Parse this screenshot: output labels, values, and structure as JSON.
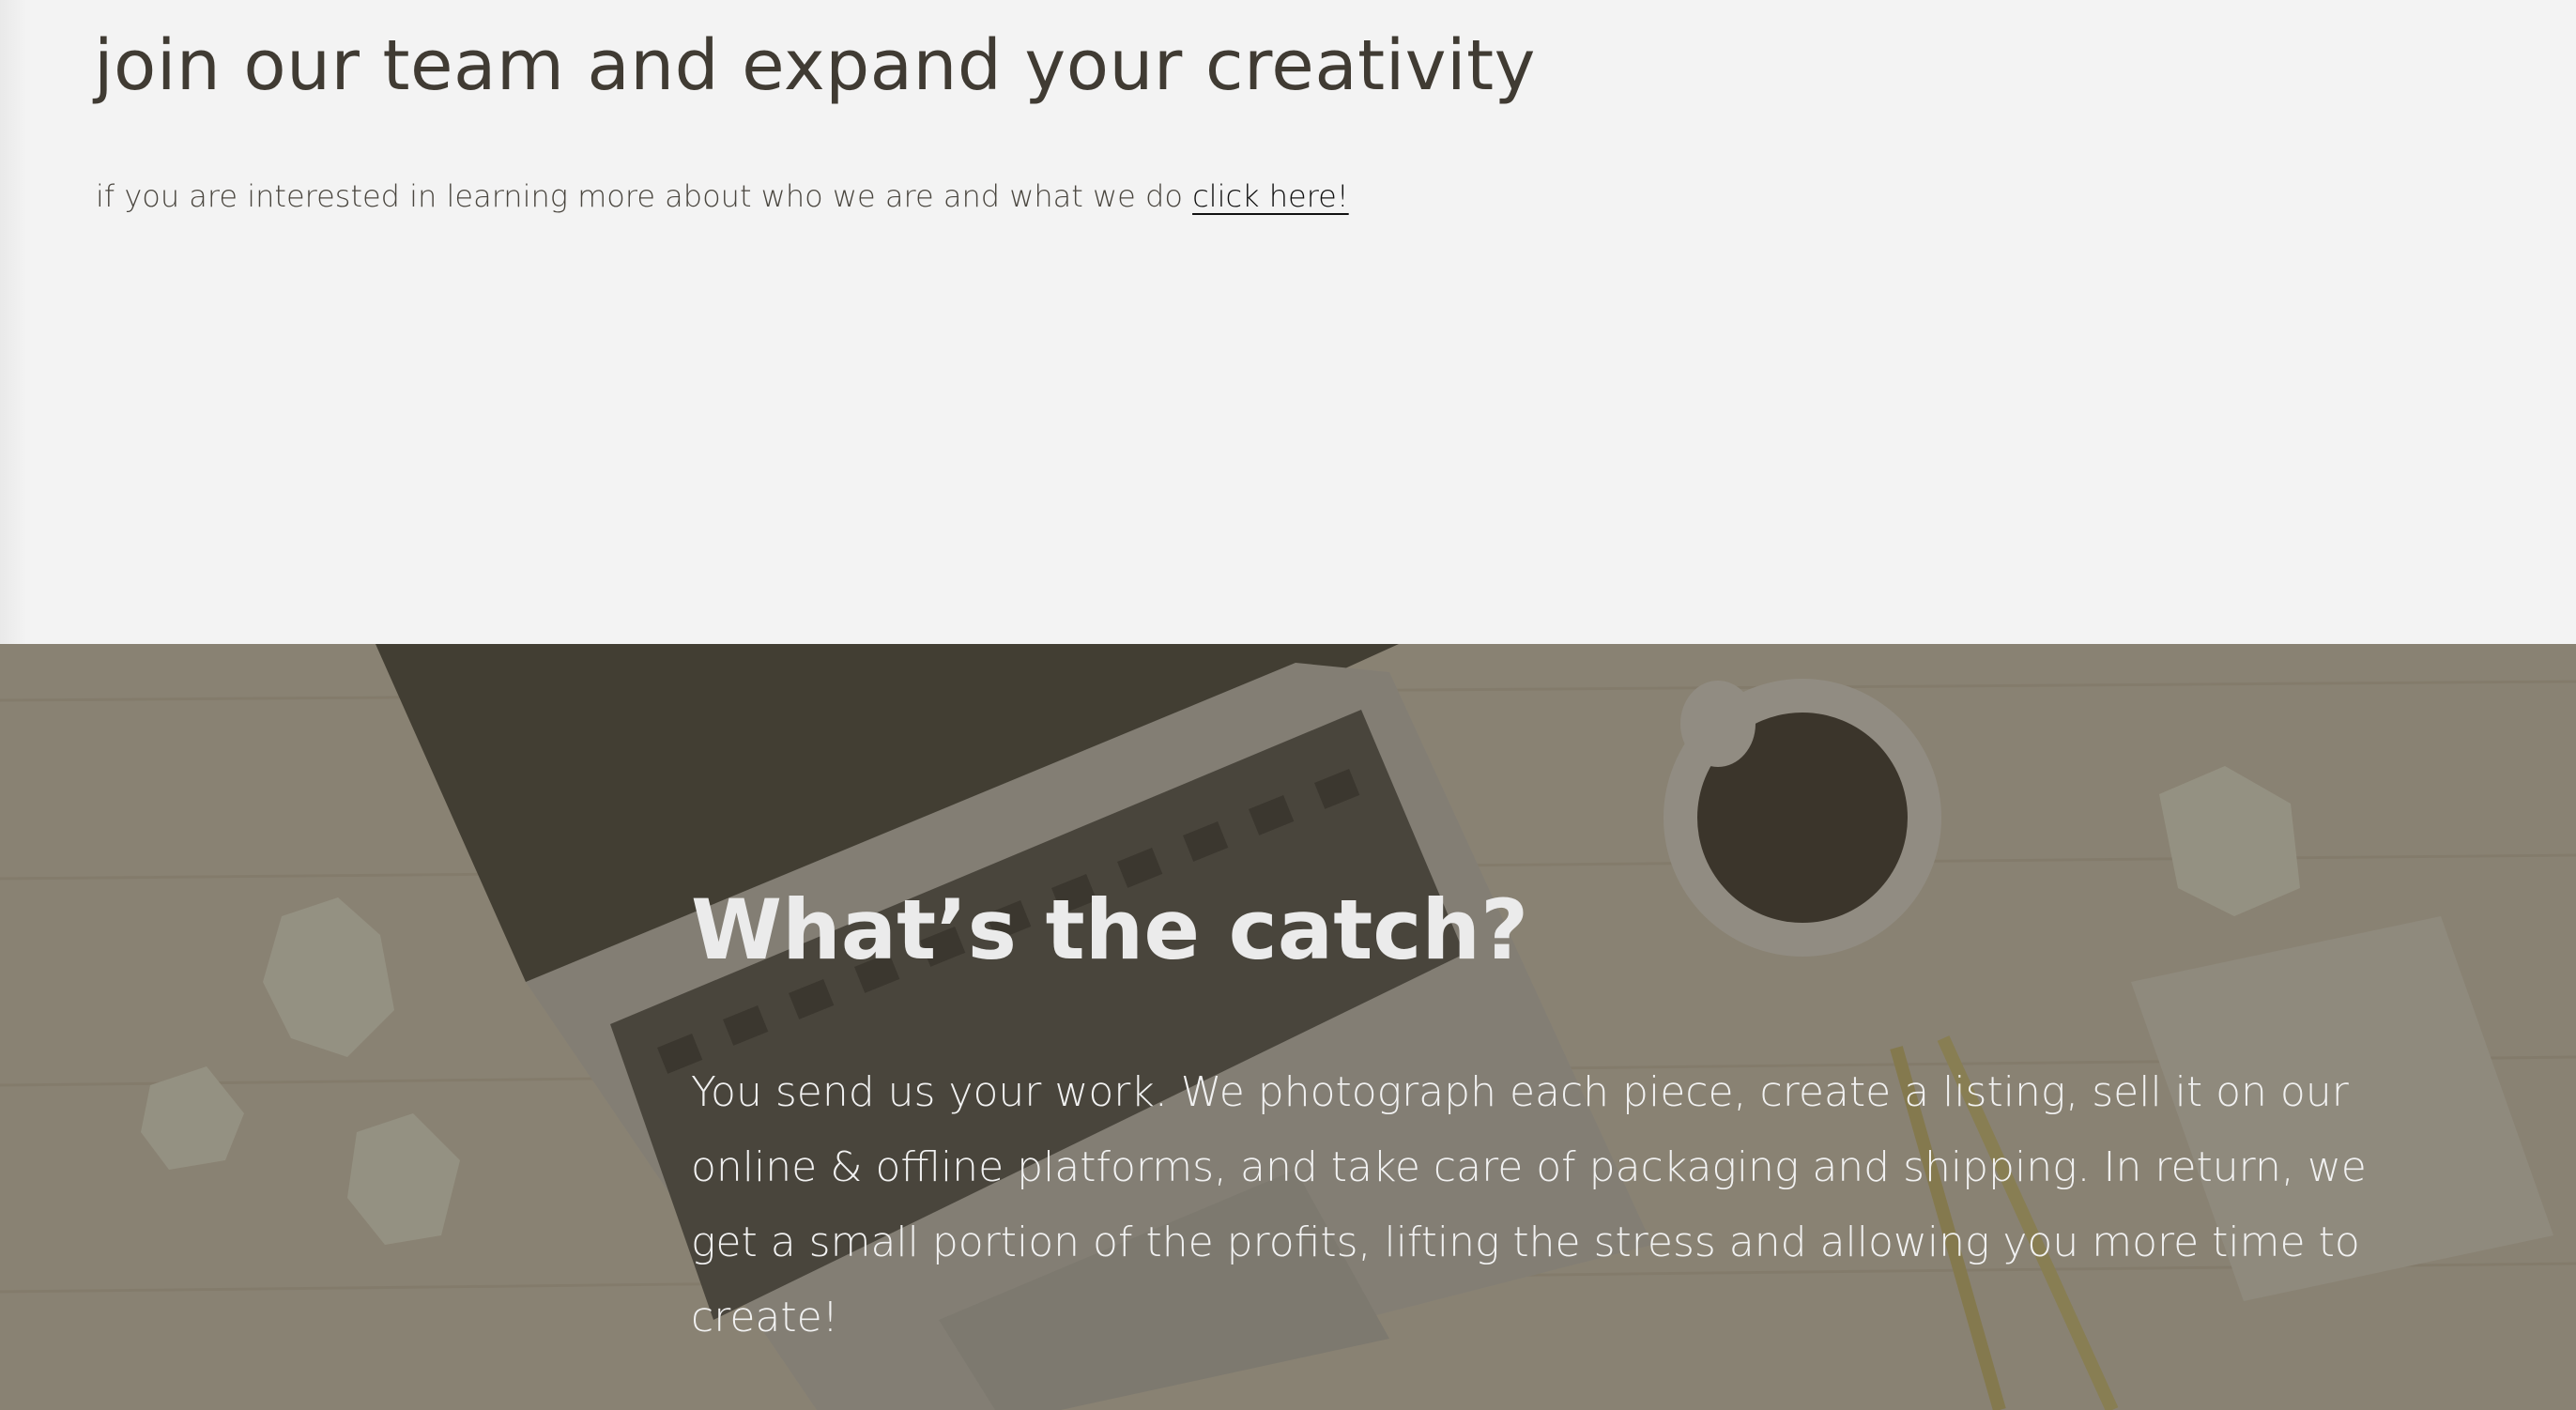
{
  "join": {
    "heading": "join our team and expand your creativity",
    "text": "if you are interested in learning more about who we are and what we do ",
    "link_label": "click here!"
  },
  "catch": {
    "heading": "What’s the catch?",
    "body": "You send us your work.  We photograph each piece, create a listing, sell it on our online & offline platforms, and take care of packaging and shipping.  In return, we get a small portion of the profits, lifting the stress and allowing you more time to create!"
  },
  "colors": {
    "page_background": "#f3f3f3",
    "heading_text": "#403b33",
    "hero_text": "#f1f1f1",
    "hero_overlay": "#484234"
  },
  "background_image": {
    "subject": "laptop, coffee cup, crumpled paper and pencils on a wooden desk"
  }
}
